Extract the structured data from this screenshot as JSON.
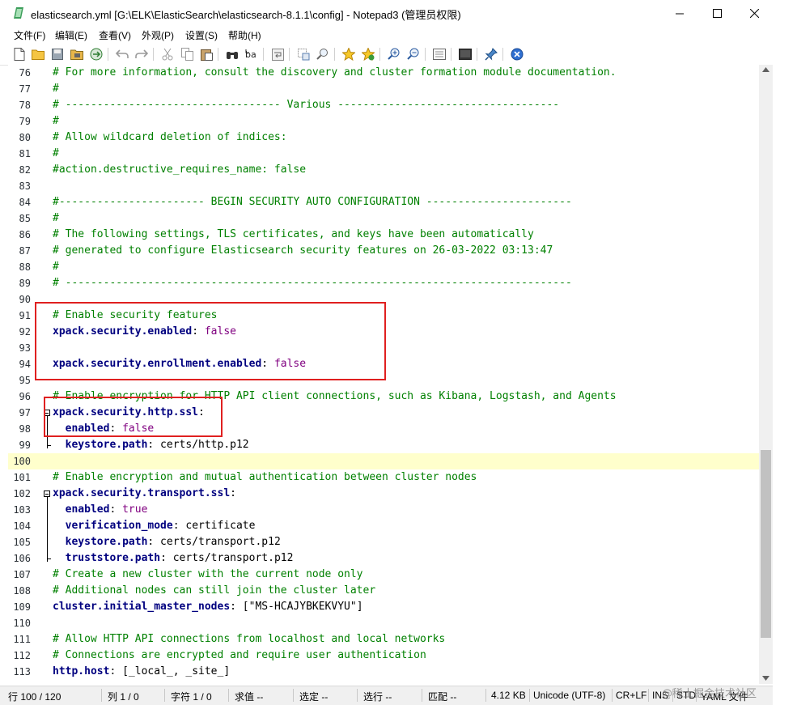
{
  "window": {
    "title": "elasticsearch.yml [G:\\ELK\\ElasticSearch\\elasticsearch-8.1.1\\config] - Notepad3  (管理员权限)"
  },
  "menu": [
    "文件(F)",
    "编辑(E)",
    "查看(V)",
    "外观(P)",
    "设置(S)",
    "帮助(H)"
  ],
  "toolbar_icons": [
    "new-file-icon",
    "open-folder-icon",
    "save-icon",
    "save-as-icon",
    "browse-icon",
    "undo-icon",
    "redo-icon",
    "cut-icon",
    "copy-icon",
    "paste-icon",
    "find-icon",
    "replace-icon",
    "word-wrap-icon",
    "select-icon",
    "find-in-files-icon",
    "bookmark-icon",
    "bookmark-all-icon",
    "zoom-in-icon",
    "zoom-out-icon",
    "settings-icon",
    "screen-icon",
    "pin-icon",
    "close-icon"
  ],
  "editor": {
    "lines": [
      {
        "n": "76",
        "parts": [
          [
            "c",
            "# For more information, consult the discovery and cluster formation module documentation."
          ]
        ]
      },
      {
        "n": "77",
        "parts": [
          [
            "c",
            "#"
          ]
        ]
      },
      {
        "n": "78",
        "parts": [
          [
            "c",
            "# ---------------------------------- Various -----------------------------------"
          ]
        ]
      },
      {
        "n": "79",
        "parts": [
          [
            "c",
            "#"
          ]
        ]
      },
      {
        "n": "80",
        "parts": [
          [
            "c",
            "# Allow wildcard deletion of indices:"
          ]
        ]
      },
      {
        "n": "81",
        "parts": [
          [
            "c",
            "#"
          ]
        ]
      },
      {
        "n": "82",
        "parts": [
          [
            "c",
            "#action.destructive_requires_name: false"
          ]
        ]
      },
      {
        "n": "83",
        "parts": []
      },
      {
        "n": "84",
        "parts": [
          [
            "c",
            "#----------------------- BEGIN SECURITY AUTO CONFIGURATION -----------------------"
          ]
        ]
      },
      {
        "n": "85",
        "parts": [
          [
            "c",
            "#"
          ]
        ]
      },
      {
        "n": "86",
        "parts": [
          [
            "c",
            "# The following settings, TLS certificates, and keys have been automatically"
          ]
        ]
      },
      {
        "n": "87",
        "parts": [
          [
            "c",
            "# generated to configure Elasticsearch security features on 26-03-2022 03:13:47"
          ]
        ]
      },
      {
        "n": "88",
        "parts": [
          [
            "c",
            "#"
          ]
        ]
      },
      {
        "n": "89",
        "parts": [
          [
            "c",
            "# --------------------------------------------------------------------------------"
          ]
        ]
      },
      {
        "n": "90",
        "parts": []
      },
      {
        "n": "91",
        "parts": [
          [
            "c",
            "# Enable security features"
          ]
        ]
      },
      {
        "n": "92",
        "parts": [
          [
            "k",
            "xpack.security.enabled"
          ],
          [
            "t",
            ": "
          ],
          [
            "v",
            "false"
          ]
        ]
      },
      {
        "n": "93",
        "parts": []
      },
      {
        "n": "94",
        "parts": [
          [
            "k",
            "xpack.security.enrollment.enabled"
          ],
          [
            "t",
            ": "
          ],
          [
            "v",
            "false"
          ]
        ]
      },
      {
        "n": "95",
        "parts": []
      },
      {
        "n": "96",
        "parts": [
          [
            "c",
            "# Enable encryption for HTTP API client connections, such as Kibana, Logstash, and Agents"
          ]
        ]
      },
      {
        "n": "97",
        "parts": [
          [
            "k",
            "xpack.security.http.ssl"
          ],
          [
            "t",
            ":"
          ]
        ]
      },
      {
        "n": "98",
        "parts": [
          [
            "t",
            "  "
          ],
          [
            "k",
            "enabled"
          ],
          [
            "t",
            ": "
          ],
          [
            "v",
            "false"
          ]
        ]
      },
      {
        "n": "99",
        "parts": [
          [
            "t",
            "  "
          ],
          [
            "k",
            "keystore.path"
          ],
          [
            "t",
            ": certs/http.p12"
          ]
        ]
      },
      {
        "n": "100",
        "parts": []
      },
      {
        "n": "101",
        "parts": [
          [
            "c",
            "# Enable encryption and mutual authentication between cluster nodes"
          ]
        ]
      },
      {
        "n": "102",
        "parts": [
          [
            "k",
            "xpack.security.transport.ssl"
          ],
          [
            "t",
            ":"
          ]
        ]
      },
      {
        "n": "103",
        "parts": [
          [
            "t",
            "  "
          ],
          [
            "k",
            "enabled"
          ],
          [
            "t",
            ": "
          ],
          [
            "v",
            "true"
          ]
        ]
      },
      {
        "n": "104",
        "parts": [
          [
            "t",
            "  "
          ],
          [
            "k",
            "verification_mode"
          ],
          [
            "t",
            ": certificate"
          ]
        ]
      },
      {
        "n": "105",
        "parts": [
          [
            "t",
            "  "
          ],
          [
            "k",
            "keystore.path"
          ],
          [
            "t",
            ": certs/transport.p12"
          ]
        ]
      },
      {
        "n": "106",
        "parts": [
          [
            "t",
            "  "
          ],
          [
            "k",
            "truststore.path"
          ],
          [
            "t",
            ": certs/transport.p12"
          ]
        ]
      },
      {
        "n": "107",
        "parts": [
          [
            "c",
            "# Create a new cluster with the current node only"
          ]
        ]
      },
      {
        "n": "108",
        "parts": [
          [
            "c",
            "# Additional nodes can still join the cluster later"
          ]
        ]
      },
      {
        "n": "109",
        "parts": [
          [
            "k",
            "cluster.initial_master_nodes"
          ],
          [
            "t",
            ": [\"MS-HCAJYBKEKVYU\"]"
          ]
        ]
      },
      {
        "n": "110",
        "parts": []
      },
      {
        "n": "111",
        "parts": [
          [
            "c",
            "# Allow HTTP API connections from localhost and local networks"
          ]
        ]
      },
      {
        "n": "112",
        "parts": [
          [
            "c",
            "# Connections are encrypted and require user authentication"
          ]
        ]
      },
      {
        "n": "113",
        "parts": [
          [
            "k",
            "http.host"
          ],
          [
            "t",
            ": [_local_, _site_]"
          ]
        ]
      }
    ],
    "current_line": "100"
  },
  "status": {
    "line": "行  100 / 120",
    "col": "列  1 / 0",
    "char": "字符  1 / 0",
    "eval": "求值  --",
    "sel": "选定  --",
    "sel_lines": "选行  --",
    "match": "匹配  --",
    "size": "4.12 KB",
    "encoding": "Unicode (UTF-8)",
    "eol": "CR+LF",
    "ins": "INS",
    "std": "STD",
    "lexer": "YAML 文件"
  },
  "watermark": "@稀土掘金技术社区",
  "colors": {
    "comment": "#008000",
    "key": "#00007f",
    "value": "#800080",
    "highlight_box": "#e02020",
    "current_line": "#ffffcc"
  }
}
